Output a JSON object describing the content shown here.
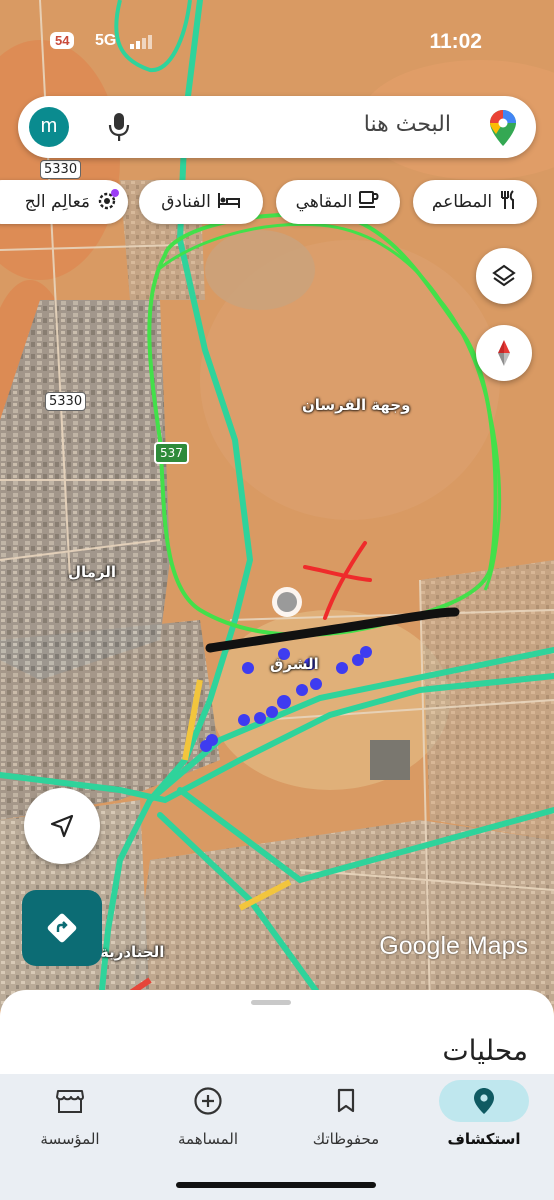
{
  "status_bar": {
    "time": "11:02",
    "battery": "54",
    "network": "5G"
  },
  "search": {
    "placeholder": "البحث هنا",
    "avatar_letter": "m",
    "mic_icon": "mic-icon",
    "logo_icon": "google-maps-pin-icon"
  },
  "chips": [
    {
      "label": "المطاعم",
      "icon": "fork-knife-icon"
    },
    {
      "label": "المقاهي",
      "icon": "coffee-icon"
    },
    {
      "label": "الفنادق",
      "icon": "bed-icon"
    },
    {
      "label": "مَعالِم الج",
      "icon": "camera-gear-icon"
    }
  ],
  "map": {
    "labels": {
      "area_1": "وجهة الفرسان",
      "area_2": "الرمال",
      "area_3": "الشرق",
      "area_4": "الجنادرية"
    },
    "road_shields": [
      "5330",
      "5330",
      "537"
    ],
    "watermark": "Google Maps",
    "colors": {
      "desert": "#d99a63",
      "urban": "#a7a39a",
      "road_green": "#2fd39b",
      "annotation_green": "#43e04a",
      "annotation_red": "#ef2b2b",
      "annotation_blue": "#3e3cf0",
      "annotation_black": "#111111"
    }
  },
  "map_buttons": {
    "layers": "layers-icon",
    "compass": "compass-icon",
    "my_location": "navigation-arrow-icon",
    "directions": "directions-icon"
  },
  "bottom_sheet": {
    "title": "محليات"
  },
  "nav": {
    "items": [
      {
        "label": "استكشاف",
        "icon": "location-pin-icon",
        "active": true
      },
      {
        "label": "محفوظاتك",
        "icon": "bookmark-icon",
        "active": false
      },
      {
        "label": "المساهمة",
        "icon": "add-circle-icon",
        "active": false
      },
      {
        "label": "المؤسسة",
        "icon": "storefront-icon",
        "active": false
      }
    ]
  }
}
